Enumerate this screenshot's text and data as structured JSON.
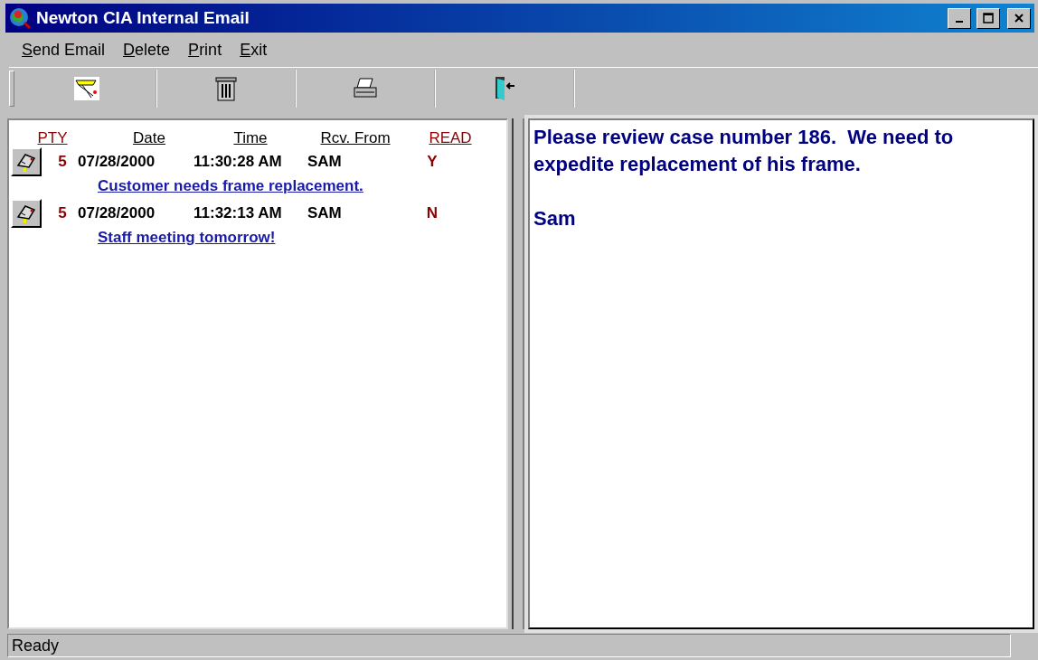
{
  "window": {
    "title": "Newton CIA Internal Email"
  },
  "menu": [
    {
      "label": "Send Email"
    },
    {
      "label": "Delete"
    },
    {
      "label": "Print"
    },
    {
      "label": "Exit"
    }
  ],
  "toolbar": [
    {
      "kind": "compose"
    },
    {
      "kind": "delete"
    },
    {
      "kind": "print"
    },
    {
      "kind": "exit"
    }
  ],
  "inbox": {
    "columns": [
      {
        "label": "PTY",
        "color": "#8b0000"
      },
      {
        "label": "Date",
        "color": "#000000"
      },
      {
        "label": "Time",
        "color": "#000000"
      },
      {
        "label": "Rcv. From",
        "color": "#000000"
      },
      {
        "label": "READ",
        "color": "#8b0000"
      }
    ],
    "rows": [
      {
        "priority": "5",
        "date": "07/28/2000",
        "time": "11:30:28 AM",
        "from": "SAM",
        "read": "Y",
        "subject": "Customer needs frame replacement."
      },
      {
        "priority": "5",
        "date": "07/28/2000",
        "time": "11:32:13 AM",
        "from": "SAM",
        "read": "N",
        "subject": "Staff meeting tomorrow!"
      }
    ]
  },
  "message": {
    "paragraphs": [
      "Please review case number 186.  We need to expedite replacement of his frame.",
      "Sam"
    ]
  },
  "status_bar": {
    "text": "Ready"
  }
}
